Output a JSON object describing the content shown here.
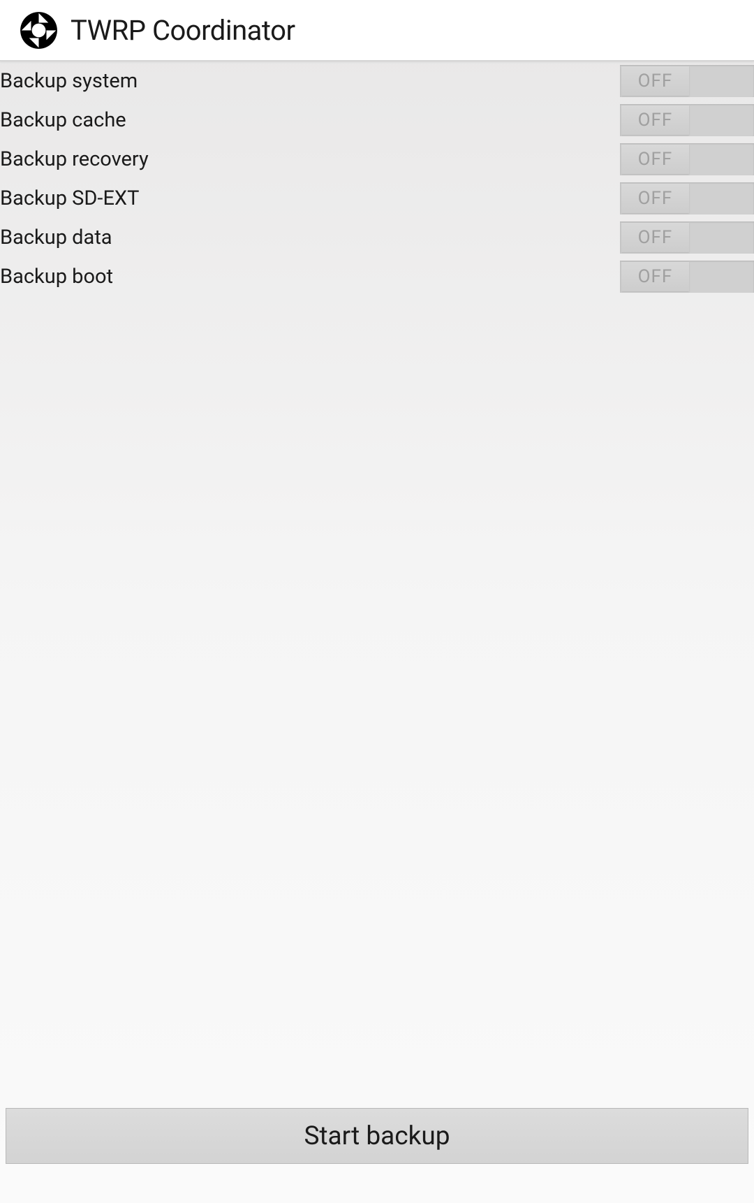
{
  "header": {
    "title": "TWRP Coordinator",
    "icon": "twrp-icon"
  },
  "options": [
    {
      "label": "Backup system",
      "state": "OFF"
    },
    {
      "label": "Backup cache",
      "state": "OFF"
    },
    {
      "label": "Backup recovery",
      "state": "OFF"
    },
    {
      "label": "Backup SD-EXT",
      "state": "OFF"
    },
    {
      "label": "Backup data",
      "state": "OFF"
    },
    {
      "label": "Backup boot",
      "state": "OFF"
    }
  ],
  "footer": {
    "button_label": "Start backup"
  }
}
